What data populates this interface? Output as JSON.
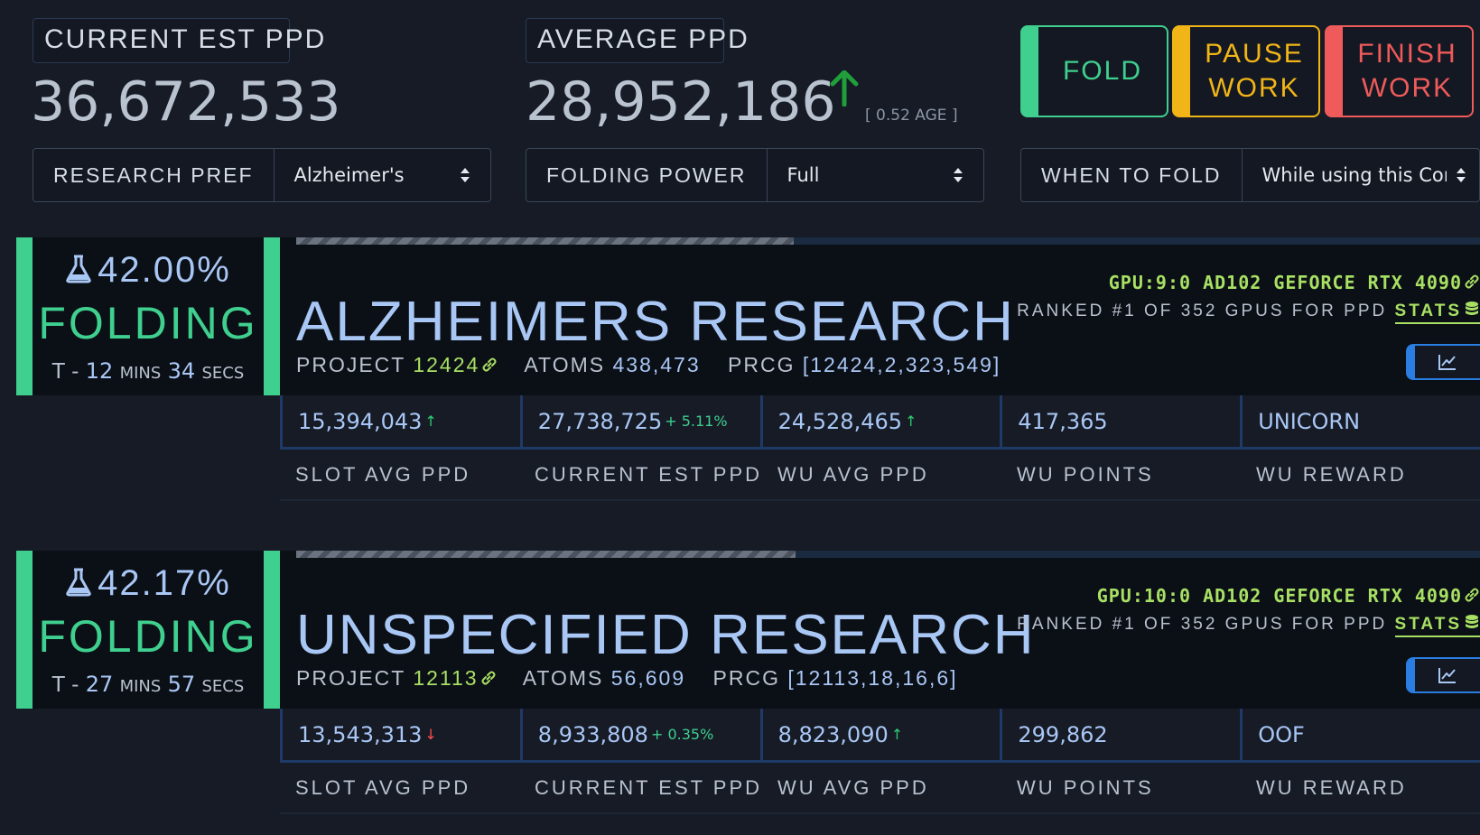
{
  "stats": {
    "current_est_ppd": {
      "label": "CURRENT EST PPD",
      "value": "36,672,533"
    },
    "average_ppd": {
      "label": "AVERAGE PPD",
      "value": "28,952,186",
      "age": "[ 0.52 AGE ]"
    }
  },
  "actions": {
    "fold": "FOLD",
    "pause_line1": "PAUSE",
    "pause_line2": "WORK",
    "finish_line1": "FINISH",
    "finish_line2": "WORK"
  },
  "selectors": {
    "research_pref": {
      "label": "RESEARCH PREF",
      "value": "Alzheimer's"
    },
    "folding_power": {
      "label": "FOLDING POWER",
      "value": "Full"
    },
    "when_to_fold": {
      "label": "WHEN TO FOLD",
      "value": "While using this Compu"
    }
  },
  "colors": {
    "accent_green": "#3fcf8e",
    "accent_yellow": "#f2b518",
    "accent_red": "#ef5b5b",
    "lime": "#a8e063",
    "text_blue": "#a9c7f5"
  },
  "work_units": [
    {
      "percent": "42.00%",
      "progress": 0.42,
      "state": "FOLDING",
      "eta_prefix": "T -",
      "eta_mins": "12",
      "eta_mins_unit": "MINS",
      "eta_secs": "34",
      "eta_secs_unit": "SECS",
      "title": "ALZHEIMERS RESEARCH",
      "project_label": "PROJECT",
      "project": "12424",
      "atoms_label": "ATOMS",
      "atoms": "438,473",
      "prcg_label": "PRCG",
      "prcg": "[12424,2,323,549]",
      "gpu": "GPU:9:0 AD102 GEFORCE RTX 4090",
      "rank": "RANKED #1 OF 352 GPUS FOR PPD",
      "stats_link": "STATS",
      "metrics": {
        "slot_avg_ppd": "15,394,043",
        "slot_avg_trend": "↑",
        "current_est_ppd": "27,738,725",
        "current_est_change": "+ 5.11%",
        "wu_avg_ppd": "24,528,465",
        "wu_avg_trend": "↑",
        "wu_points": "417,365",
        "wu_reward": "UNICORN"
      }
    },
    {
      "percent": "42.17%",
      "progress": 0.4217,
      "state": "FOLDING",
      "eta_prefix": "T -",
      "eta_mins": "27",
      "eta_mins_unit": "MINS",
      "eta_secs": "57",
      "eta_secs_unit": "SECS",
      "title": "UNSPECIFIED RESEARCH",
      "project_label": "PROJECT",
      "project": "12113",
      "atoms_label": "ATOMS",
      "atoms": "56,609",
      "prcg_label": "PRCG",
      "prcg": "[12113,18,16,6]",
      "gpu": "GPU:10:0 AD102 GEFORCE RTX 4090",
      "rank": "RANKED #1 OF 352 GPUS FOR PPD",
      "stats_link": "STATS",
      "metrics": {
        "slot_avg_ppd": "13,543,313",
        "slot_avg_trend": "↓",
        "current_est_ppd": "8,933,808",
        "current_est_change": "+ 0.35%",
        "wu_avg_ppd": "8,823,090",
        "wu_avg_trend": "↑",
        "wu_points": "299,862",
        "wu_reward": "OOF"
      }
    }
  ],
  "metric_labels": {
    "slot_avg_ppd": "SLOT AVG PPD",
    "current_est_ppd": "CURRENT EST PPD",
    "wu_avg_ppd": "WU AVG PPD",
    "wu_points": "WU POINTS",
    "wu_reward": "WU REWARD"
  }
}
